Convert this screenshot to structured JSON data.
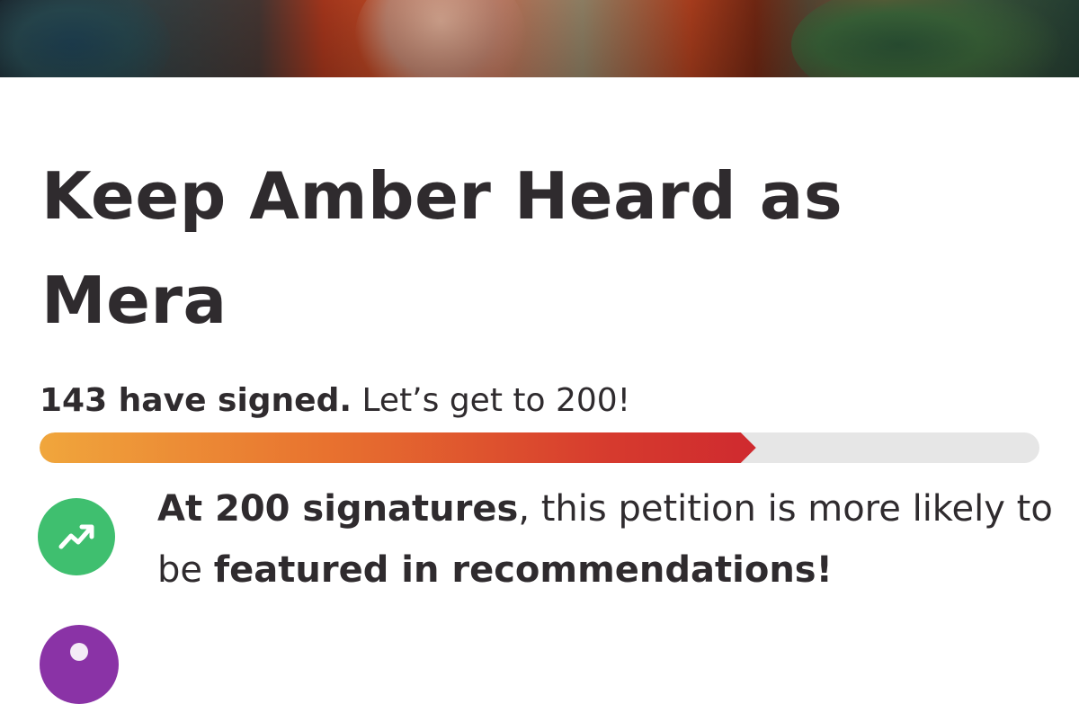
{
  "petition": {
    "title": "Keep Amber Heard as Mera"
  },
  "progress": {
    "signed_label": "143 have signed.",
    "goal_label": " Let’s get to 200!",
    "signed": 143,
    "goal": 200,
    "fill_fraction": 0.7165,
    "colors": {
      "start": "#f0a63c",
      "mid": "#e8722f",
      "end": "#cf2a2f",
      "track": "#e6e6e6"
    }
  },
  "milestone": {
    "lead_bold": "At 200 signatures",
    "middle": ", this petition is more likely to be ",
    "tail_bold": "featured in recommendations!",
    "icon": "trending-up-icon",
    "icon_color": "#3fbf6f"
  },
  "next_item": {
    "icon_color": "#8a33a6"
  }
}
